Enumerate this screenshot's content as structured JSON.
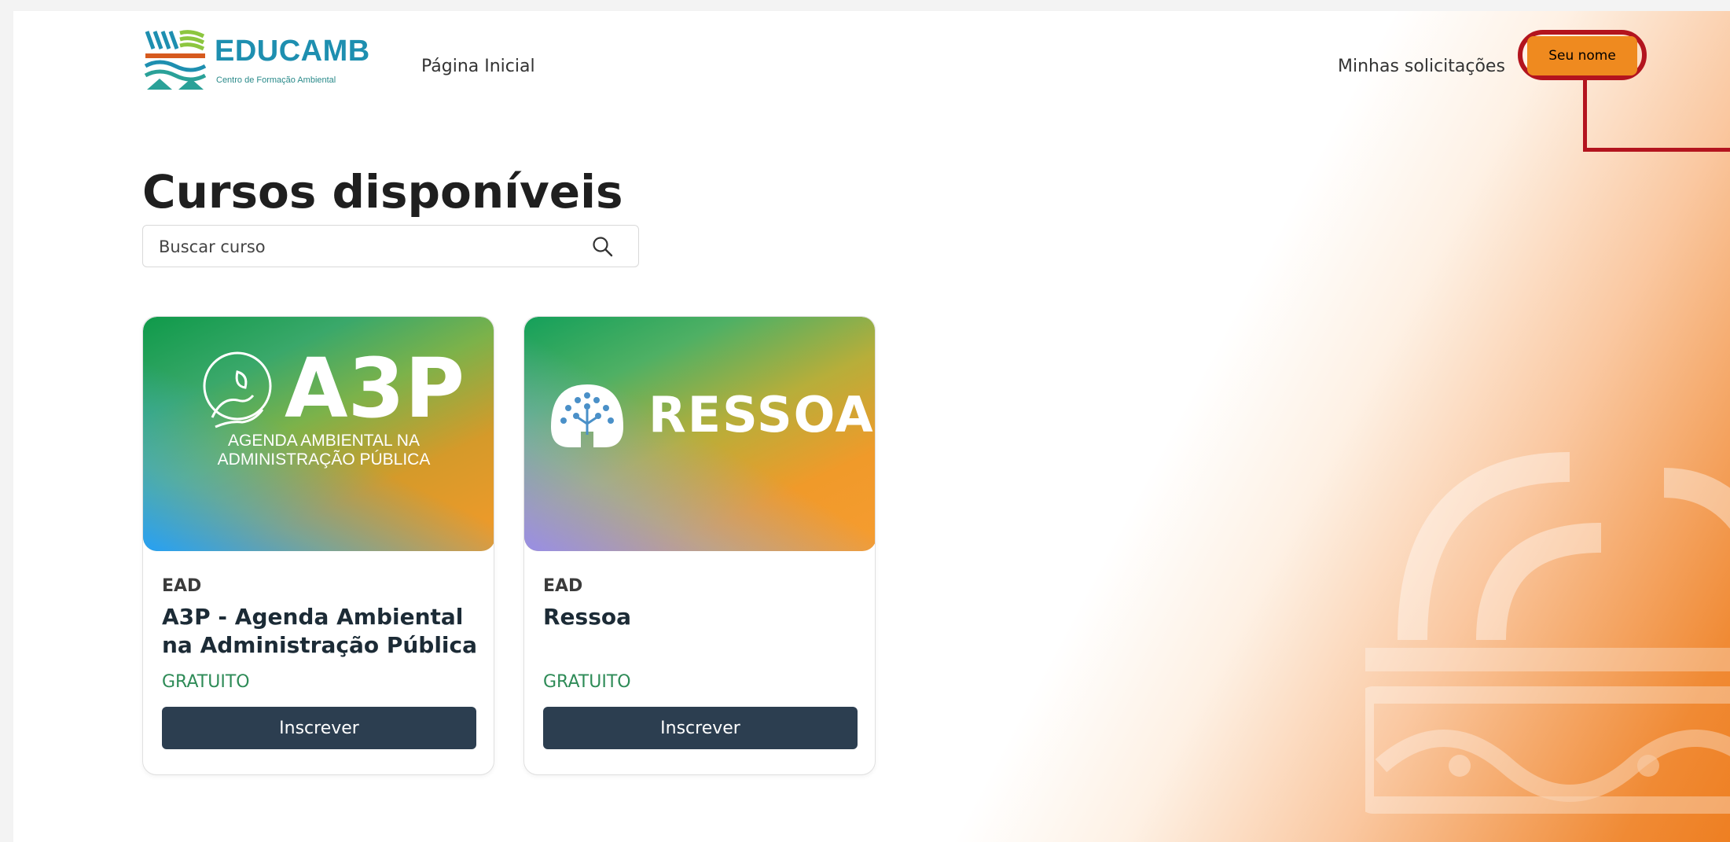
{
  "header": {
    "logo_text": "EDUCAMB",
    "logo_subtitle": "Centro de Formação Ambiental",
    "nav_home": "Página Inicial",
    "nav_requests": "Minhas solicitações",
    "user_button": "Seu nome"
  },
  "main": {
    "title": "Cursos disponíveis",
    "search": {
      "placeholder": "Buscar curso",
      "value": ""
    }
  },
  "courses": [
    {
      "banner_title": "A3P",
      "banner_subtitle_line1": "AGENDA AMBIENTAL NA",
      "banner_subtitle_line2": "ADMINISTRAÇÃO PÚBLICA",
      "modality": "EAD",
      "title": "A3P - Agenda Ambiental na Administração Pública",
      "price": "GRATUITO",
      "action": "Inscrever"
    },
    {
      "banner_title": "RESSOA",
      "modality": "EAD",
      "title": "Ressoa",
      "price": "GRATUITO",
      "action": "Inscrever"
    }
  ],
  "colors": {
    "accent_orange": "#ef8a1f",
    "highlight_red": "#b3141e",
    "button_dark": "#2c3e50",
    "price_green": "#2e8b57"
  }
}
